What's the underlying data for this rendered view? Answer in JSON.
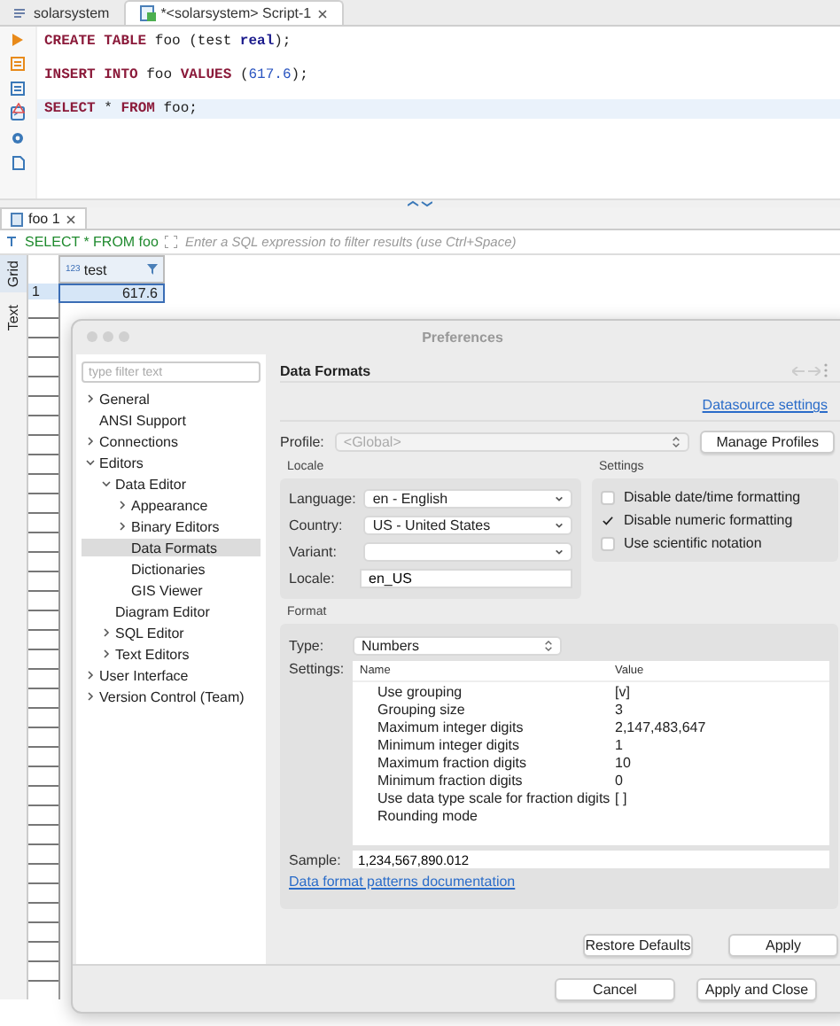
{
  "editor_tabs": [
    {
      "label": "solarsystem",
      "selected": false
    },
    {
      "label": "*<solarsystem> Script-1",
      "selected": true
    }
  ],
  "code_lines": [
    {
      "current": false,
      "warning": false,
      "tokens": [
        {
          "kind": "keyword",
          "text": "CREATE TABLE"
        },
        {
          "kind": "plain",
          "text": " foo (test "
        },
        {
          "kind": "type",
          "text": "real"
        },
        {
          "kind": "plain",
          "text": ");"
        }
      ]
    },
    {
      "current": false,
      "warning": false,
      "tokens": [
        {
          "kind": "keyword",
          "text": "INSERT INTO"
        },
        {
          "kind": "plain",
          "text": " foo "
        },
        {
          "kind": "keyword",
          "text": "VALUES"
        },
        {
          "kind": "plain",
          "text": " ("
        },
        {
          "kind": "number",
          "text": "617.6"
        },
        {
          "kind": "plain",
          "text": ");"
        }
      ]
    },
    {
      "current": true,
      "warning": true,
      "tokens": [
        {
          "kind": "keyword",
          "text": "SELECT"
        },
        {
          "kind": "plain",
          "text": " * "
        },
        {
          "kind": "keyword",
          "text": "FROM"
        },
        {
          "kind": "plain",
          "text": " foo;"
        }
      ]
    }
  ],
  "result_tabs": [
    {
      "label": "foo 1",
      "selected": true
    }
  ],
  "filter": {
    "query": "SELECT * FROM foo",
    "placeholder": "Enter a SQL expression to filter results (use Ctrl+Space)"
  },
  "view_tabs": [
    {
      "label": "Grid",
      "selected": true
    },
    {
      "label": "Text",
      "selected": false
    }
  ],
  "grid": {
    "columns": [
      {
        "type_badge": "123",
        "name": "test"
      }
    ],
    "rows": [
      {
        "number": "1",
        "cells": [
          "617.6"
        ],
        "selected": true
      }
    ]
  },
  "dialog": {
    "title": "Preferences",
    "filter_placeholder": "type filter text",
    "tree": [
      {
        "label": "General",
        "expanded": false,
        "selected": false
      },
      {
        "label": "ANSI Support",
        "selected": false
      },
      {
        "label": "Connections",
        "expanded": false,
        "selected": false
      },
      {
        "label": "Editors",
        "expanded": true,
        "selected": false,
        "children": [
          {
            "label": "Data Editor",
            "expanded": true,
            "selected": false,
            "children": [
              {
                "label": "Appearance",
                "expanded": false,
                "selected": false
              },
              {
                "label": "Binary Editors",
                "expanded": false,
                "selected": false
              },
              {
                "label": "Data Formats",
                "selected": true
              },
              {
                "label": "Dictionaries",
                "selected": false
              },
              {
                "label": "GIS Viewer",
                "selected": false
              }
            ]
          },
          {
            "label": "Diagram Editor",
            "selected": false
          },
          {
            "label": "SQL Editor",
            "expanded": false,
            "selected": false
          },
          {
            "label": "Text Editors",
            "expanded": false,
            "selected": false
          }
        ]
      },
      {
        "label": "User Interface",
        "expanded": false,
        "selected": false
      },
      {
        "label": "Version Control (Team)",
        "expanded": false,
        "selected": false
      }
    ],
    "page_title": "Data Formats",
    "datasource_link": "Datasource settings",
    "profile": {
      "label": "Profile:",
      "value": "<Global>",
      "disabled": true
    },
    "manage_profiles_button": "Manage Profiles",
    "locale": {
      "title": "Locale",
      "fields": [
        {
          "label": "Language:",
          "value": "en - English",
          "kind": "select"
        },
        {
          "label": "Country:",
          "value": "US - United States",
          "kind": "select"
        },
        {
          "label": "Variant:",
          "kind": "select"
        },
        {
          "label": "Locale:",
          "value": "en_US",
          "kind": "text"
        }
      ]
    },
    "settings": {
      "title": "Settings",
      "checkboxes": [
        {
          "label": "Disable date/time formatting",
          "checked": false
        },
        {
          "label": "Disable numeric formatting",
          "checked": true
        },
        {
          "label": "Use scientific notation",
          "checked": false
        }
      ]
    },
    "format": {
      "title": "Format",
      "type_label": "Type:",
      "type_value": "Numbers",
      "settings_label": "Settings:",
      "columns": [
        "Name",
        "Value"
      ],
      "rows": [
        {
          "name": "Use grouping",
          "value": "[v]"
        },
        {
          "name": "Grouping size",
          "value": "3"
        },
        {
          "name": "Maximum integer digits",
          "value": "2,147,483,647"
        },
        {
          "name": "Minimum integer digits",
          "value": "1"
        },
        {
          "name": "Maximum fraction digits",
          "value": "10"
        },
        {
          "name": "Minimum fraction digits",
          "value": "0"
        },
        {
          "name": "Use data type scale for fraction digits",
          "value": "[ ]"
        },
        {
          "name": "Rounding mode"
        }
      ],
      "sample_label": "Sample:",
      "sample_value": "1,234,567,890.012",
      "docs_link": "Data format patterns documentation"
    },
    "page_buttons": [
      "Restore Defaults",
      "Apply"
    ],
    "dialog_buttons": [
      "Cancel",
      "Apply and Close"
    ]
  }
}
